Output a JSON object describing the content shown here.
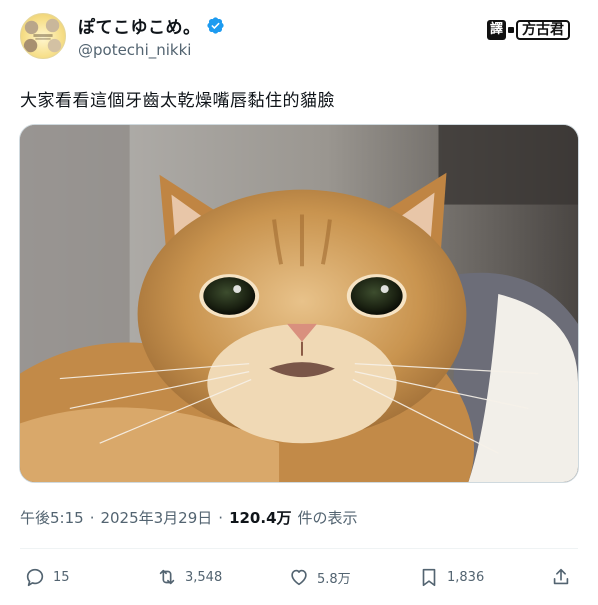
{
  "author": {
    "display_name": "ぽてこゆこめ。",
    "handle": "@potechi_nikki",
    "verified": true,
    "avatar_icon": "cat-avatar-icon",
    "accent_color": "#1d9bf0"
  },
  "watermark": {
    "prefix": "譯",
    "label": "方古君"
  },
  "tweet": {
    "text": "大家看看這個牙齒太乾燥嘴唇黏住的貓臉"
  },
  "media": {
    "image_icon": "cat-photo"
  },
  "meta": {
    "time": "午後5:15",
    "date": "2025年3月29日",
    "separator": "·",
    "views_count": "120.4万",
    "views_label": "件の表示"
  },
  "actions": {
    "replies": "15",
    "retweets": "3,548",
    "likes": "5.8万",
    "bookmarks": "1,836"
  },
  "colors": {
    "text_primary": "#0f1419",
    "text_secondary": "#536471",
    "divider": "#eff3f4"
  }
}
